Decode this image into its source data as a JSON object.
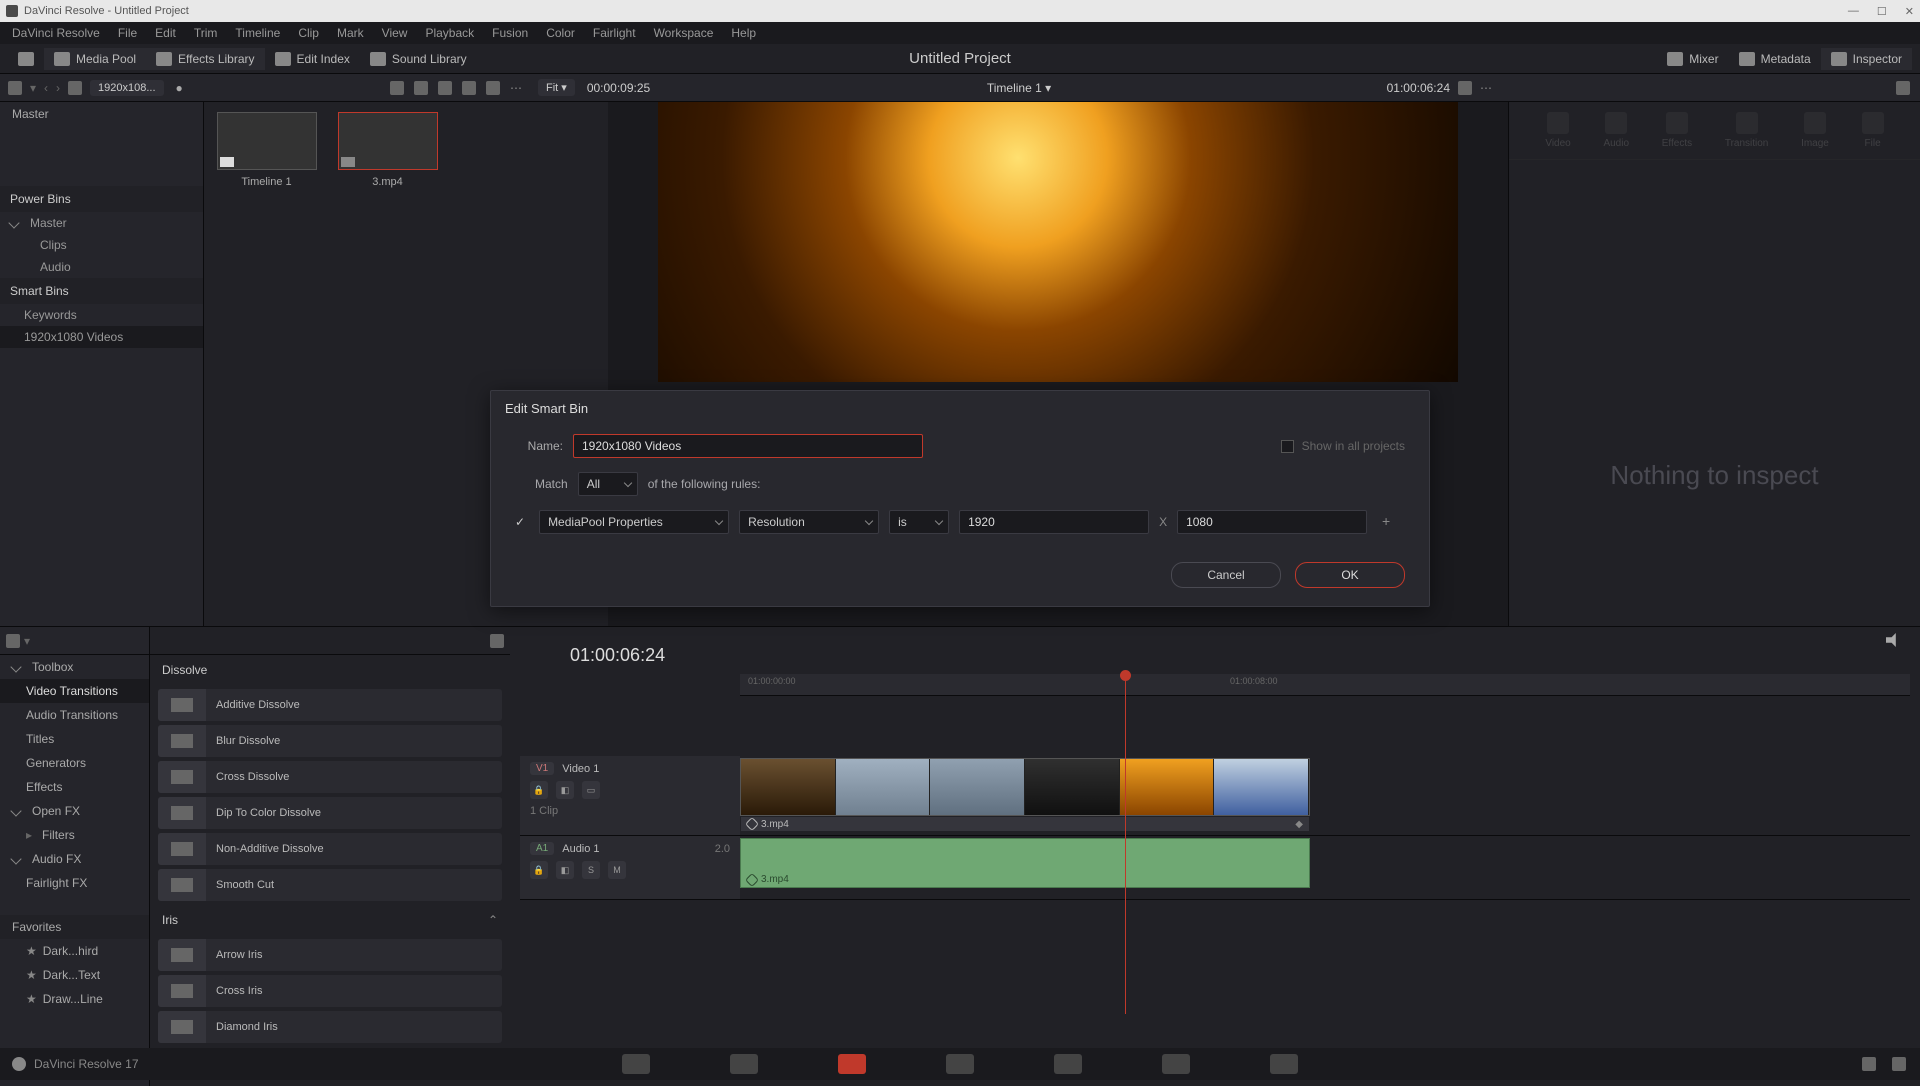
{
  "titlebar": "DaVinci Resolve - Untitled Project",
  "menu": [
    "DaVinci Resolve",
    "File",
    "Edit",
    "Trim",
    "Timeline",
    "Clip",
    "Mark",
    "View",
    "Playback",
    "Fusion",
    "Color",
    "Fairlight",
    "Workspace",
    "Help"
  ],
  "toolbar": {
    "mediapool": "Media Pool",
    "fx": "Effects Library",
    "editindex": "Edit Index",
    "sound": "Sound Library",
    "mixer": "Mixer",
    "metadata": "Metadata",
    "inspector": "Inspector"
  },
  "project_title": "Untitled Project",
  "secondbar": {
    "crumb": "1920x108...",
    "fit": "Fit",
    "tc_left": "00:00:09:25",
    "timeline_name": "Timeline 1",
    "tc_right": "01:00:06:24"
  },
  "sidebar": {
    "master": "Master",
    "power_bins": "Power Bins",
    "pb_master": "Master",
    "pb_clips": "Clips",
    "pb_audio": "Audio",
    "smart_bins": "Smart Bins",
    "sb_keywords": "Keywords",
    "sb_videos": "1920x1080 Videos"
  },
  "clips": [
    {
      "label": "Timeline 1"
    },
    {
      "label": "3.mp4"
    }
  ],
  "inspector_tabs": [
    "Video",
    "Audio",
    "Effects",
    "Transition",
    "Image",
    "File"
  ],
  "nothing": "Nothing to inspect",
  "fx_sidebar": {
    "toolbox": "Toolbox",
    "video_trans": "Video Transitions",
    "audio_trans": "Audio Transitions",
    "titles": "Titles",
    "generators": "Generators",
    "effects": "Effects",
    "openfx": "Open FX",
    "filters": "Filters",
    "audiofx": "Audio FX",
    "fairlight": "Fairlight FX",
    "favorites": "Favorites",
    "fav1": "Dark...hird",
    "fav2": "Dark...Text",
    "fav3": "Draw...Line"
  },
  "fx_groups": {
    "dissolve": "Dissolve",
    "dissolve_items": [
      "Additive Dissolve",
      "Blur Dissolve",
      "Cross Dissolve",
      "Dip To Color Dissolve",
      "Non-Additive Dissolve",
      "Smooth Cut"
    ],
    "iris": "Iris",
    "iris_items": [
      "Arrow Iris",
      "Cross Iris",
      "Diamond Iris"
    ]
  },
  "timeline": {
    "tc": "01:00:06:24",
    "ticks": [
      "01:00:00:00",
      "01:00:08:00"
    ],
    "v1_badge": "V1",
    "v1_name": "Video 1",
    "v1_clips": "1 Clip",
    "v1_cliplabel": "3.mp4",
    "a1_badge": "A1",
    "a1_name": "Audio 1",
    "a1_ch": "2.0",
    "a1_cliplabel": "3.mp4"
  },
  "version": "DaVinci Resolve 17",
  "modal": {
    "title": "Edit Smart Bin",
    "name_label": "Name:",
    "name_value": "1920x1080 Videos",
    "show_all": "Show in all projects",
    "match": "Match",
    "match_value": "All",
    "rules_suffix": "of the following rules:",
    "prop": "MediaPool Properties",
    "field": "Resolution",
    "op": "is",
    "w": "1920",
    "h": "1080",
    "cancel": "Cancel",
    "ok": "OK"
  }
}
